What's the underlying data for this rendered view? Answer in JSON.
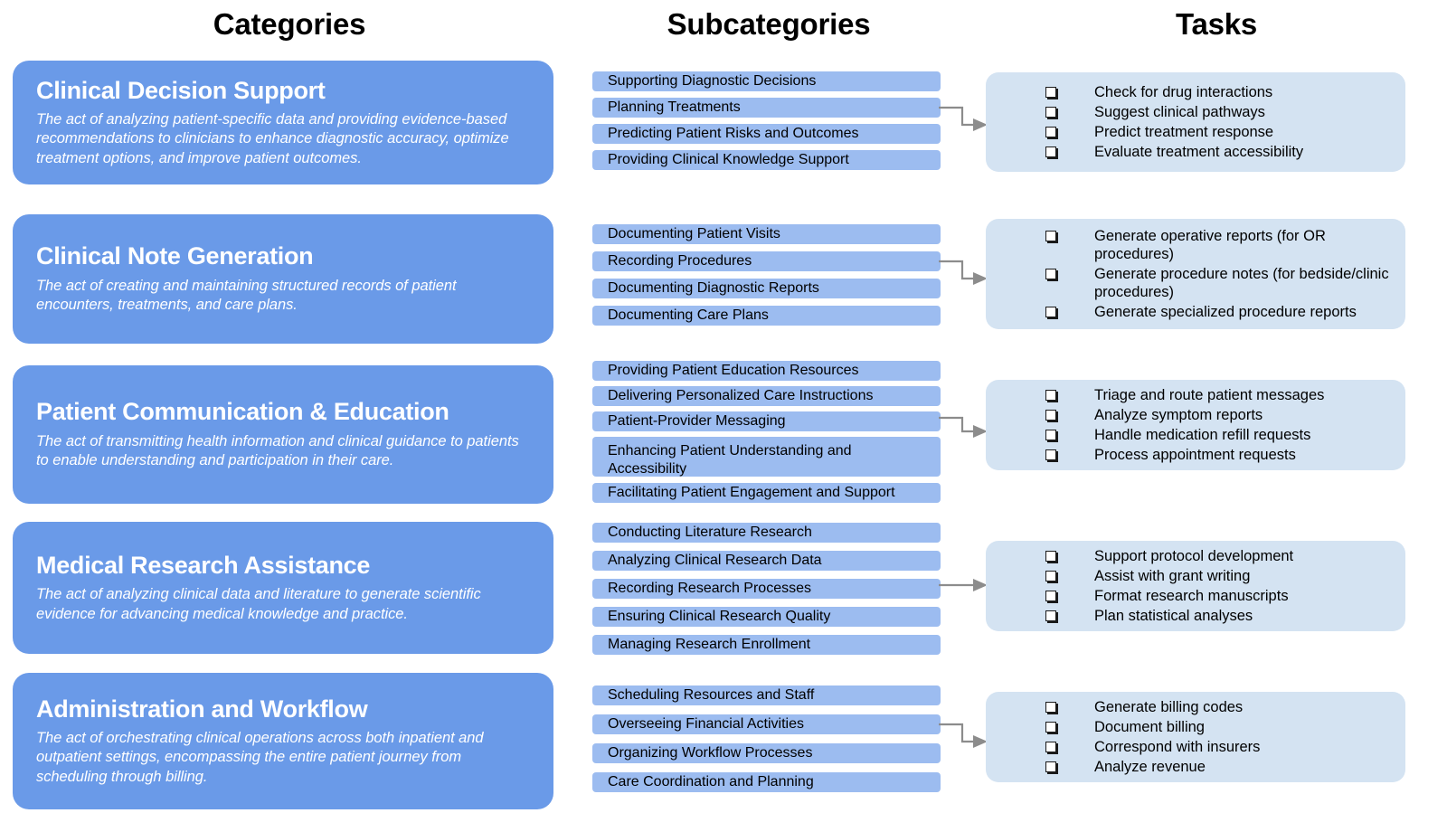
{
  "headers": {
    "categories": "Categories",
    "subcategories": "Subcategories",
    "tasks": "Tasks"
  },
  "colors": {
    "category_blue": "#6a9ae8",
    "subcategory_blue": "#9cbcf0",
    "task_box_blue": "#d4e3f2",
    "connector_gray": "#8c8c8c",
    "category_text": "#ffffff",
    "body_text": "#000000",
    "page_background": "#ffffff"
  },
  "icons": {
    "task_bullet": "checkbox-square-icon",
    "connector": "elbow-arrow-icon"
  },
  "rows": [
    {
      "category": {
        "title": "Clinical Decision Support",
        "description": "The act of analyzing patient-specific data and providing evidence-based recommendations to clinicians to enhance diagnostic accuracy, optimize treatment options, and improve patient outcomes."
      },
      "subcategories": [
        "Supporting Diagnostic Decisions",
        "Planning Treatments",
        "Predicting Patient Risks and Outcomes",
        "Providing Clinical Knowledge Support"
      ],
      "tasks": [
        "Check for drug interactions",
        "Suggest clinical pathways",
        "Predict treatment response",
        "Evaluate treatment accessibility"
      ]
    },
    {
      "category": {
        "title": "Clinical Note Generation",
        "description": "The act of creating and maintaining structured records of patient encounters, treatments, and care plans."
      },
      "subcategories": [
        "Documenting Patient Visits",
        "Recording Procedures",
        "Documenting Diagnostic Reports",
        "Documenting Care Plans"
      ],
      "tasks": [
        "Generate operative reports (for OR procedures)",
        "Generate procedure notes (for bedside/clinic procedures)",
        "Generate specialized procedure reports"
      ]
    },
    {
      "category": {
        "title": "Patient Communication & Education",
        "description": "The act of transmitting health information and clinical guidance to patients to enable understanding and participation in their care."
      },
      "subcategories": [
        "Providing Patient Education Resources",
        "Delivering Personalized Care Instructions",
        "Patient-Provider Messaging",
        "Enhancing Patient Understanding and Accessibility",
        "Facilitating Patient Engagement and Support"
      ],
      "tasks": [
        "Triage and route patient messages",
        "Analyze symptom reports",
        "Handle medication refill requests",
        "Process appointment requests"
      ]
    },
    {
      "category": {
        "title": "Medical Research Assistance",
        "description": "The act of analyzing clinical data and literature to generate scientific evidence for advancing medical knowledge and practice."
      },
      "subcategories": [
        "Conducting Literature Research",
        "Analyzing Clinical Research Data",
        "Recording Research Processes",
        "Ensuring Clinical Research Quality",
        "Managing Research Enrollment"
      ],
      "tasks": [
        "Support protocol development",
        "Assist with grant writing",
        "Format research manuscripts",
        "Plan statistical analyses"
      ]
    },
    {
      "category": {
        "title": "Administration and Workflow",
        "description": "The act of orchestrating clinical operations across both inpatient and outpatient settings, encompassing the entire patient journey from scheduling through billing."
      },
      "subcategories": [
        "Scheduling Resources and Staff",
        "Overseeing Financial Activities",
        "Organizing Workflow Processes",
        "Care Coordination and Planning"
      ],
      "tasks": [
        "Generate billing codes",
        "Document billing",
        "Correspond with insurers",
        "Analyze revenue"
      ]
    }
  ]
}
